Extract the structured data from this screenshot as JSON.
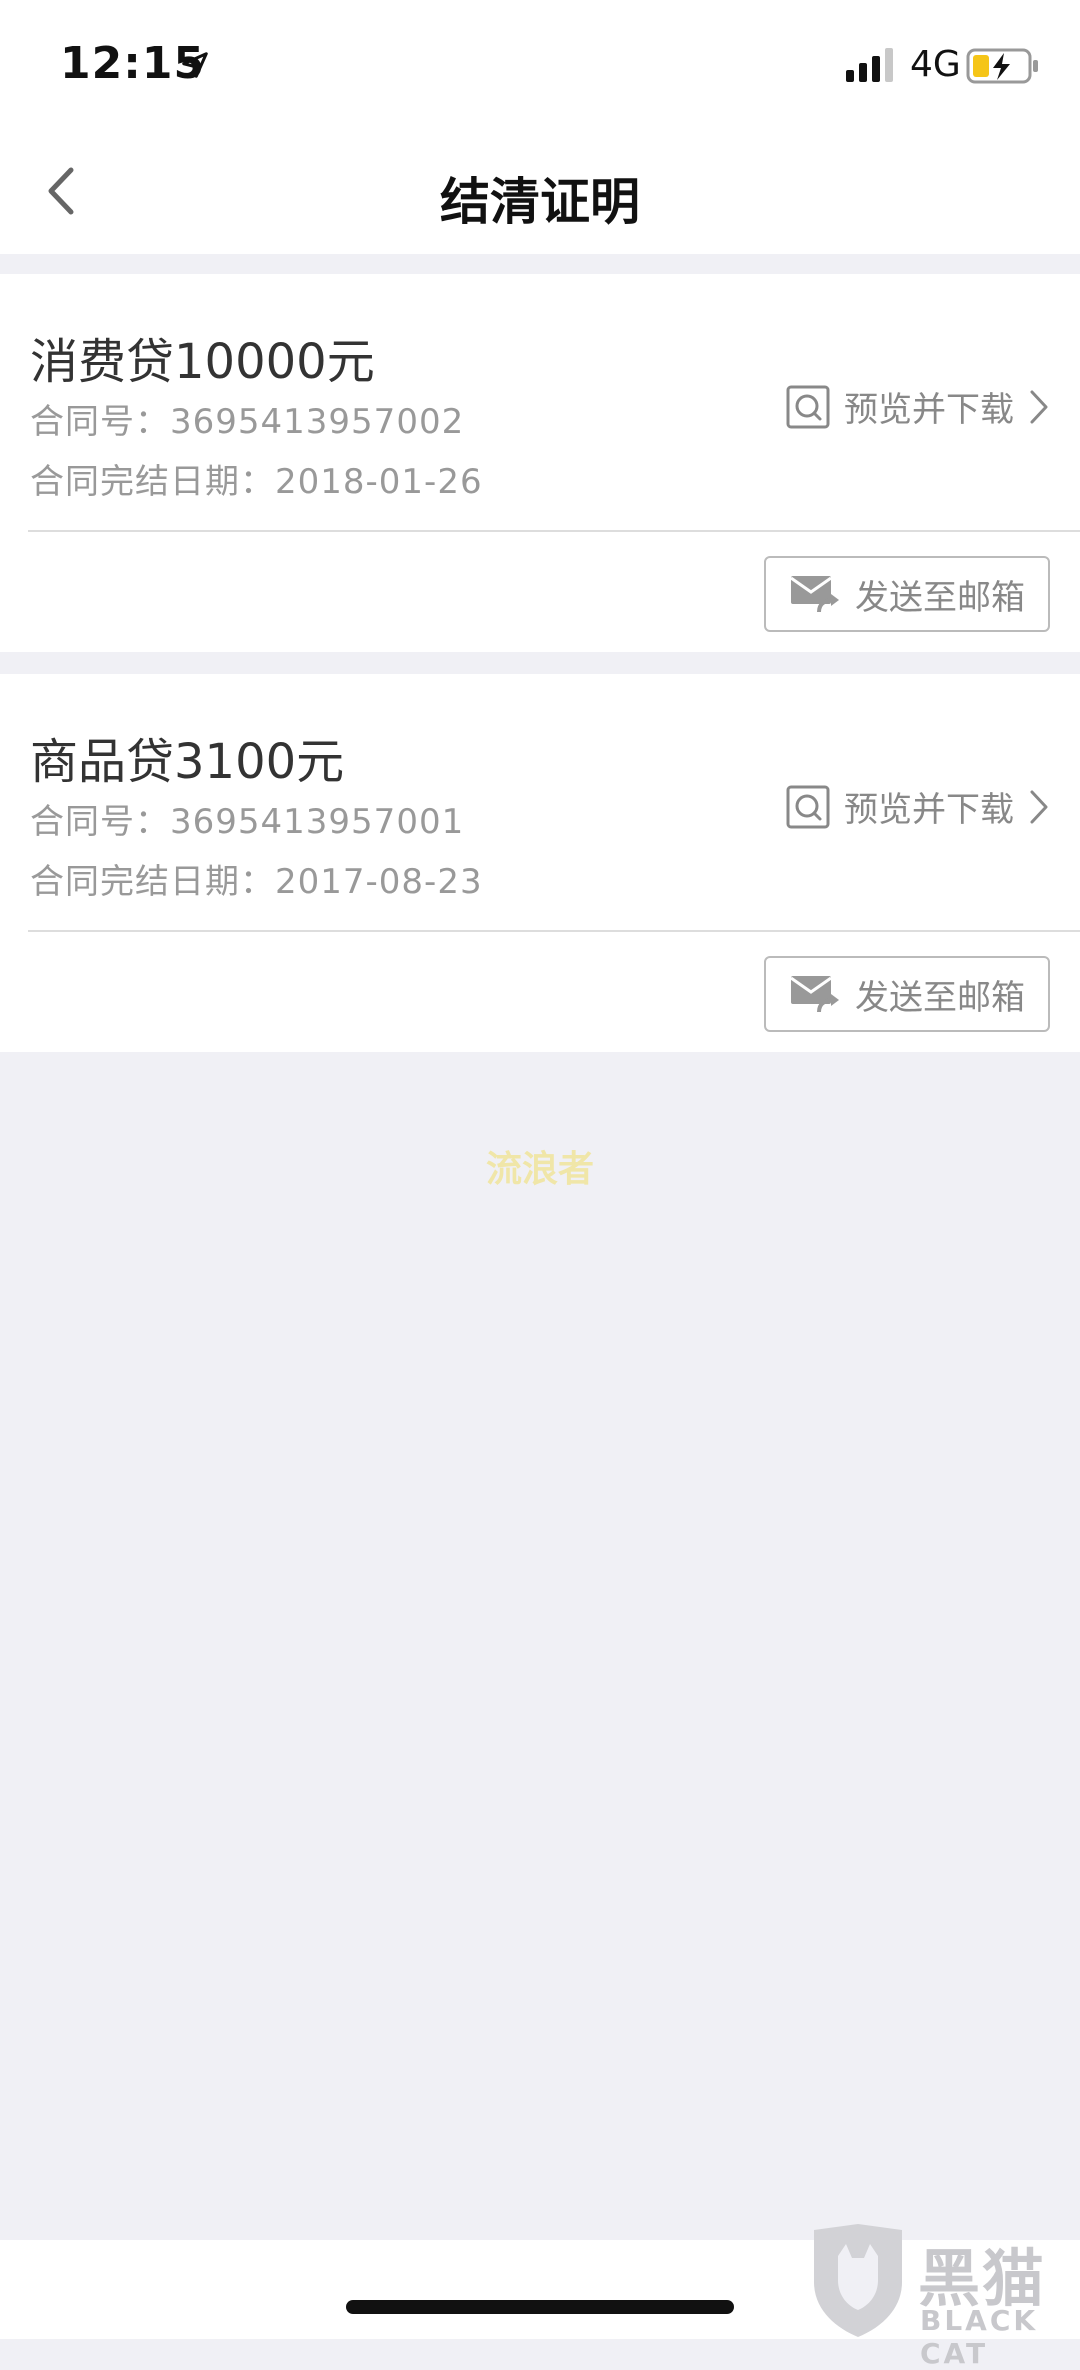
{
  "status_bar": {
    "time": "12:15",
    "network": "4G",
    "icons": [
      "location-arrow-icon",
      "signal-icon",
      "battery-charging-icon"
    ]
  },
  "nav": {
    "title": "结清证明",
    "back_icon": "chevron-left-icon"
  },
  "loans": [
    {
      "title": "消费贷10000元",
      "contract": "合同号：3695413957002",
      "end_date": "合同完结日期：2018-01-26",
      "preview_label": "预览并下载",
      "email_label": "发送至邮箱"
    },
    {
      "title": "商品贷3100元",
      "contract": "合同号：3695413957001",
      "end_date": "合同完结日期：2017-08-23",
      "preview_label": "预览并下载",
      "email_label": "发送至邮箱"
    }
  ],
  "watermark": "流浪者",
  "brand": {
    "name_cn": "黑猫",
    "name_en": "BLACK CAT"
  },
  "colors": {
    "background": "#f0f0f5",
    "card": "#ffffff",
    "muted_text": "#999999",
    "watermark": "#f0e6a8"
  }
}
